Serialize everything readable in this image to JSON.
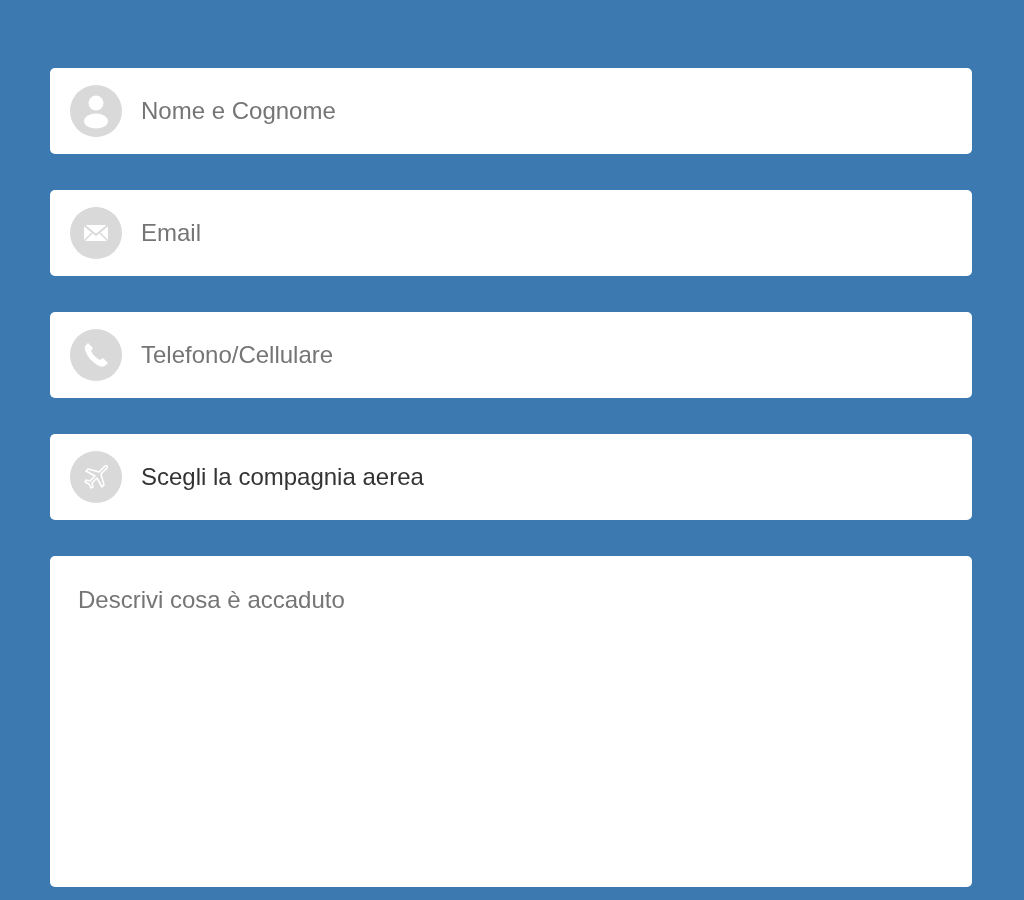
{
  "form": {
    "fields": [
      {
        "kind": "input",
        "placeholder": "Nome e Cognome"
      },
      {
        "kind": "input",
        "placeholder": "Email"
      },
      {
        "kind": "input",
        "placeholder": "Telefono/Cellulare"
      },
      {
        "kind": "select",
        "value": "Scegli la compagnia aerea"
      }
    ],
    "message": {
      "placeholder": "Descrivi cosa è accaduto"
    }
  }
}
